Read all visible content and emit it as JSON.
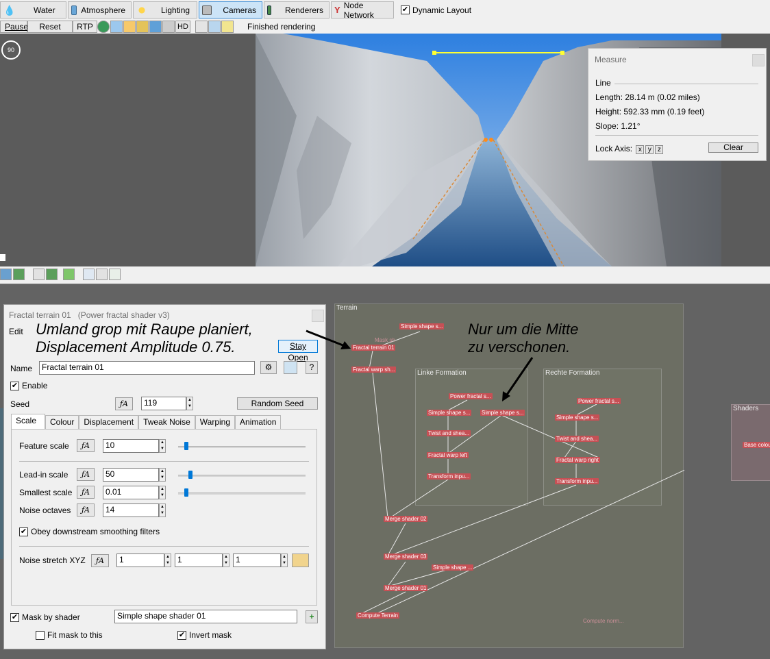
{
  "toolbar": {
    "buttons": [
      {
        "label": "Water",
        "icon": "water-drop-icon"
      },
      {
        "label": "Atmosphere",
        "icon": "atmosphere-icon"
      },
      {
        "label": "Lighting",
        "icon": "sun-icon"
      },
      {
        "label": "Cameras",
        "icon": "camera-icon"
      },
      {
        "label": "Renderers",
        "icon": "renderer-icon"
      },
      {
        "label": "Node Network",
        "icon": "node-network-icon"
      }
    ],
    "dynamic_layout_label": "Dynamic Layout"
  },
  "render_bar": {
    "pause": "Pause",
    "reset": "Reset",
    "rtp": "RTP",
    "hd": "HD",
    "status": "Finished rendering"
  },
  "compass": {
    "value": "90"
  },
  "measure": {
    "title": "Measure",
    "section": "Line",
    "length": "Length: 28.14 m  (0.02 miles)",
    "height": "Height: 592.33 mm  (0.19 feet)",
    "slope": "Slope: 1.21°",
    "lock_axis_label": "Lock Axis:",
    "axes": [
      "x",
      "y",
      "z"
    ],
    "clear": "Clear"
  },
  "props": {
    "title": "Fractal terrain 01",
    "subtitle": "(Power fractal shader v3)",
    "edit": "Edit",
    "stay_open": "Stay Open",
    "name_label": "Name",
    "name_value": "Fractal terrain 01",
    "enable_label": "Enable",
    "seed_label": "Seed",
    "seed_value": "119",
    "random_seed": "Random Seed",
    "tabs": [
      "Scale",
      "Colour",
      "Displacement",
      "Tweak Noise",
      "Warping",
      "Animation"
    ],
    "fields": {
      "feature_scale": {
        "label": "Feature scale",
        "value": "10"
      },
      "lead_in_scale": {
        "label": "Lead-in scale",
        "value": "50"
      },
      "smallest_scale": {
        "label": "Smallest scale",
        "value": "0.01"
      },
      "noise_octaves": {
        "label": "Noise octaves",
        "value": "14"
      }
    },
    "obey_label": "Obey downstream smoothing filters",
    "noise_stretch_label": "Noise stretch XYZ",
    "noise_stretch": [
      "1",
      "1",
      "1"
    ],
    "mask_label": "Mask by shader",
    "mask_value": "Simple shape shader 01",
    "fit_mask_label": "Fit mask to this",
    "invert_mask_label": "Invert mask"
  },
  "annotations": {
    "left_line1": "Umland grop mit Raupe planiert,",
    "left_line2": "Displacement Amplitude 0.75.",
    "right_line1": "Nur um die Mitte",
    "right_line2": "zu verschonen."
  },
  "network": {
    "terrain_label": "Terrain",
    "linke_label": "Linke Formation",
    "rechte_label": "Rechte Formation",
    "shaders_label": "Shaders",
    "nodes": {
      "n1": "Simple shape s...",
      "n2": "Fractal terrain 01",
      "n3": "Fractal warp sh...",
      "n4": "Power fractal s...",
      "n5": "Simple shape s...",
      "n6": "Simple shape s...",
      "n7": "Twist and shea...",
      "n8": "Fractal warp left",
      "n9": "Transform inpu...",
      "n10": "Power fractal s...",
      "n11": "Simple shape s...",
      "n12": "Twist and shea...",
      "n13": "Fractal warp right",
      "n14": "Transform inpu...",
      "n15": "Merge shader 02",
      "n16": "Merge shader 03",
      "n17": "Simple shape ...",
      "n18": "Merge shader 01",
      "n19": "Compute Terrain",
      "n20": "Compute norm...",
      "n21": "Base colou"
    }
  }
}
